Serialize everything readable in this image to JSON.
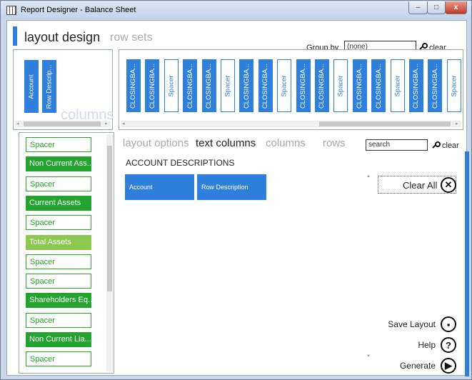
{
  "window": {
    "title": "Report Designer - Balance Sheet",
    "min_glyph": "–",
    "max_glyph": "□",
    "close_glyph": "x"
  },
  "header": {
    "tab_layout": "layout design",
    "tab_rowsets": "row sets"
  },
  "groupby": {
    "label": "Group by",
    "value": "(none)",
    "clear": "clear"
  },
  "text_columns": {
    "chips": [
      "Account",
      "Row Descrip..."
    ],
    "watermark": "columns"
  },
  "columns_strip": {
    "chips": [
      {
        "label": "CLOSINGBA...",
        "kind": "col"
      },
      {
        "label": "CLOSINGBA...",
        "kind": "col"
      },
      {
        "label": "Spacer",
        "kind": "spacer"
      },
      {
        "label": "CLOSINGBA...",
        "kind": "col"
      },
      {
        "label": "CLOSINGBA...",
        "kind": "col"
      },
      {
        "label": "Spacer",
        "kind": "spacer"
      },
      {
        "label": "CLOSINGBA...",
        "kind": "col"
      },
      {
        "label": "CLOSINGBA...",
        "kind": "col"
      },
      {
        "label": "Spacer",
        "kind": "spacer"
      },
      {
        "label": "CLOSINGBA...",
        "kind": "col"
      },
      {
        "label": "CLOSINGBA...",
        "kind": "col"
      },
      {
        "label": "Spacer",
        "kind": "spacer"
      },
      {
        "label": "CLOSINGBA...",
        "kind": "col"
      },
      {
        "label": "CLOSINGBA...",
        "kind": "col"
      },
      {
        "label": "Spacer",
        "kind": "spacer"
      },
      {
        "label": "CLOSINGBA...",
        "kind": "col"
      },
      {
        "label": "CLOSINGBA...",
        "kind": "col"
      },
      {
        "label": "Spacer",
        "kind": "spacer"
      }
    ]
  },
  "rows": [
    {
      "label": "Spacer",
      "kind": "spacer"
    },
    {
      "label": "Non Current Ass...",
      "kind": "dark"
    },
    {
      "label": "Spacer",
      "kind": "spacer"
    },
    {
      "label": "Current Assets",
      "kind": "dark"
    },
    {
      "label": "Spacer",
      "kind": "spacer"
    },
    {
      "label": "Total Assets",
      "kind": "light"
    },
    {
      "label": "Spacer",
      "kind": "spacer"
    },
    {
      "label": "Spacer",
      "kind": "spacer"
    },
    {
      "label": "Shareholders Eq...",
      "kind": "dark"
    },
    {
      "label": "Spacer",
      "kind": "spacer"
    },
    {
      "label": "Non Current Lia...",
      "kind": "dark"
    },
    {
      "label": "Spacer",
      "kind": "spacer"
    }
  ],
  "options_tabs": {
    "layout_options": "layout options",
    "text_columns": "text columns",
    "columns": "columns",
    "rows": "rows"
  },
  "search": {
    "value": "search",
    "clear": "clear"
  },
  "section": {
    "title": "ACCOUNT DESCRIPTIONS",
    "cards": [
      "Account",
      "Row Description"
    ]
  },
  "actions": {
    "clear_all": "Clear All",
    "save_layout": "Save Layout",
    "help": "Help",
    "generate": "Generate"
  },
  "colors": {
    "accent_blue": "#2f7fdc",
    "green_dark": "#24a42e",
    "green_light": "#8cc84f"
  }
}
